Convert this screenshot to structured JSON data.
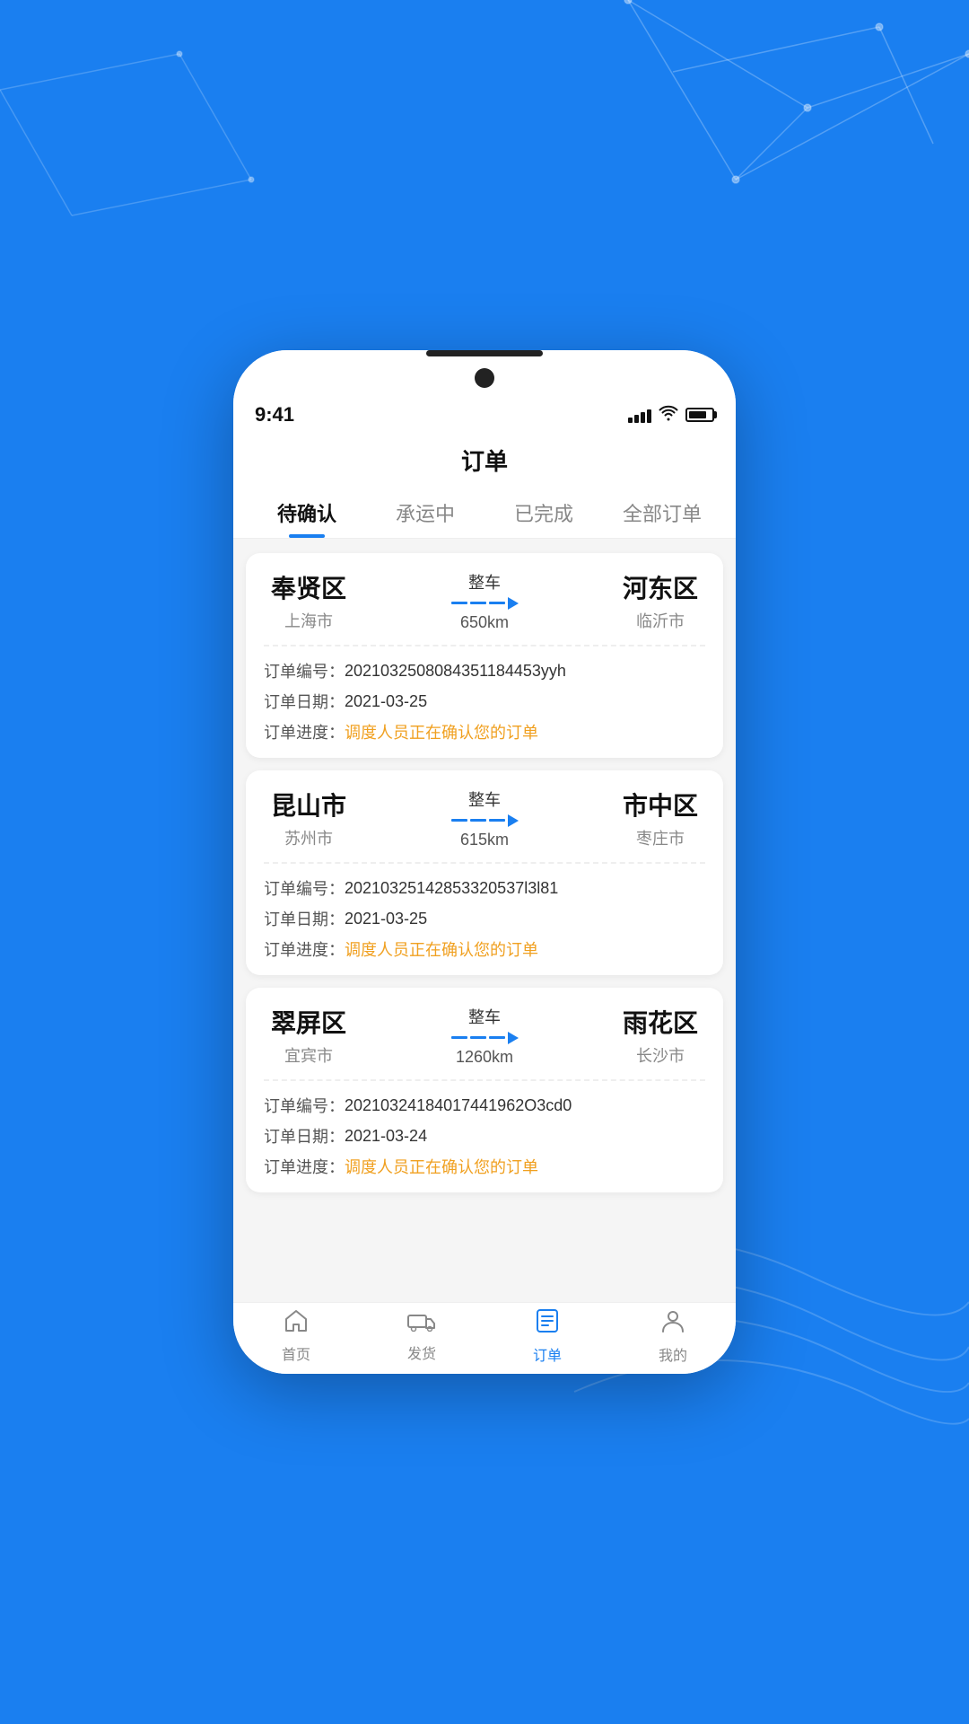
{
  "background": {
    "color": "#1a7ff0"
  },
  "status_bar": {
    "time": "9:41",
    "signal_bars": [
      6,
      9,
      12,
      14
    ],
    "wifi": "wifi",
    "battery": 80
  },
  "page": {
    "title": "订单"
  },
  "tabs": [
    {
      "id": "pending",
      "label": "待确认",
      "active": true
    },
    {
      "id": "in_transit",
      "label": "承运中",
      "active": false
    },
    {
      "id": "completed",
      "label": "已完成",
      "active": false
    },
    {
      "id": "all",
      "label": "全部订单",
      "active": false
    }
  ],
  "orders": [
    {
      "from_city": "奉贤区",
      "from_province": "上海市",
      "to_city": "河东区",
      "to_province": "临沂市",
      "route_type": "整车",
      "distance": "650km",
      "order_no_label": "订单编号：",
      "order_no": "2021032508084351184453yyh",
      "order_date_label": "订单日期：",
      "order_date": "2021-03-25",
      "order_progress_label": "订单进度：",
      "order_progress": "调度人员正在确认您的订单"
    },
    {
      "from_city": "昆山市",
      "from_province": "苏州市",
      "to_city": "市中区",
      "to_province": "枣庄市",
      "route_type": "整车",
      "distance": "615km",
      "order_no_label": "订单编号：",
      "order_no": "20210325142853320537l3l81",
      "order_date_label": "订单日期：",
      "order_date": "2021-03-25",
      "order_progress_label": "订单进度：",
      "order_progress": "调度人员正在确认您的订单"
    },
    {
      "from_city": "翠屏区",
      "from_province": "宜宾市",
      "to_city": "雨花区",
      "to_province": "长沙市",
      "route_type": "整车",
      "distance": "1260km",
      "order_no_label": "订单编号：",
      "order_no": "20210324184017441962O3cd0",
      "order_date_label": "订单日期：",
      "order_date": "2021-03-24",
      "order_progress_label": "订单进度：",
      "order_progress": "调度人员正在确认您的订单"
    }
  ],
  "bottom_nav": [
    {
      "id": "home",
      "label": "首页",
      "active": false,
      "icon": "home"
    },
    {
      "id": "send",
      "label": "发货",
      "active": false,
      "icon": "truck"
    },
    {
      "id": "orders",
      "label": "订单",
      "active": true,
      "icon": "orders"
    },
    {
      "id": "mine",
      "label": "我的",
      "active": false,
      "icon": "user"
    }
  ]
}
